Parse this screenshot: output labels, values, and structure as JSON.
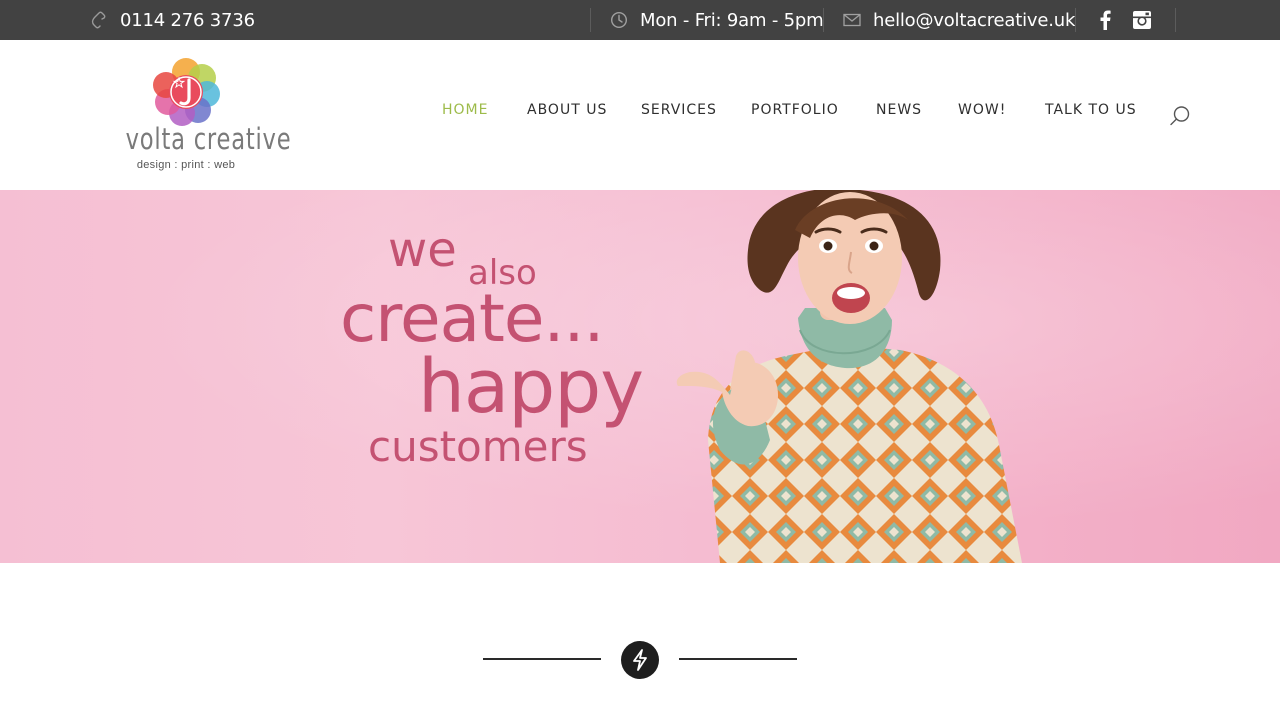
{
  "topbar": {
    "phone": "0114 276 3736",
    "hours": "Mon - Fri: 9am - 5pm",
    "email": "hello@voltacreative.uk",
    "icons": [
      "phone-icon",
      "clock-icon",
      "mail-icon",
      "facebook-icon",
      "instagram-icon"
    ]
  },
  "logo": {
    "wordmark": "volta creative",
    "tagline": "design : print : web"
  },
  "nav": {
    "items": [
      {
        "label": "HOME",
        "active": true
      },
      {
        "label": "ABOUT US",
        "active": false
      },
      {
        "label": "SERVICES",
        "active": false
      },
      {
        "label": "PORTFOLIO",
        "active": false
      },
      {
        "label": "NEWS",
        "active": false
      },
      {
        "label": "WOW!",
        "active": false
      },
      {
        "label": "TALK TO US",
        "active": false
      }
    ]
  },
  "hero": {
    "line1": "we",
    "line2": "also",
    "line3": "create...",
    "line4": "happy",
    "line5": "customers"
  },
  "colors": {
    "topbar_bg": "#424242",
    "nav_active": "#9dbb4a",
    "hero_text": "#c45272",
    "hero_bg": "#f5bfd3"
  }
}
